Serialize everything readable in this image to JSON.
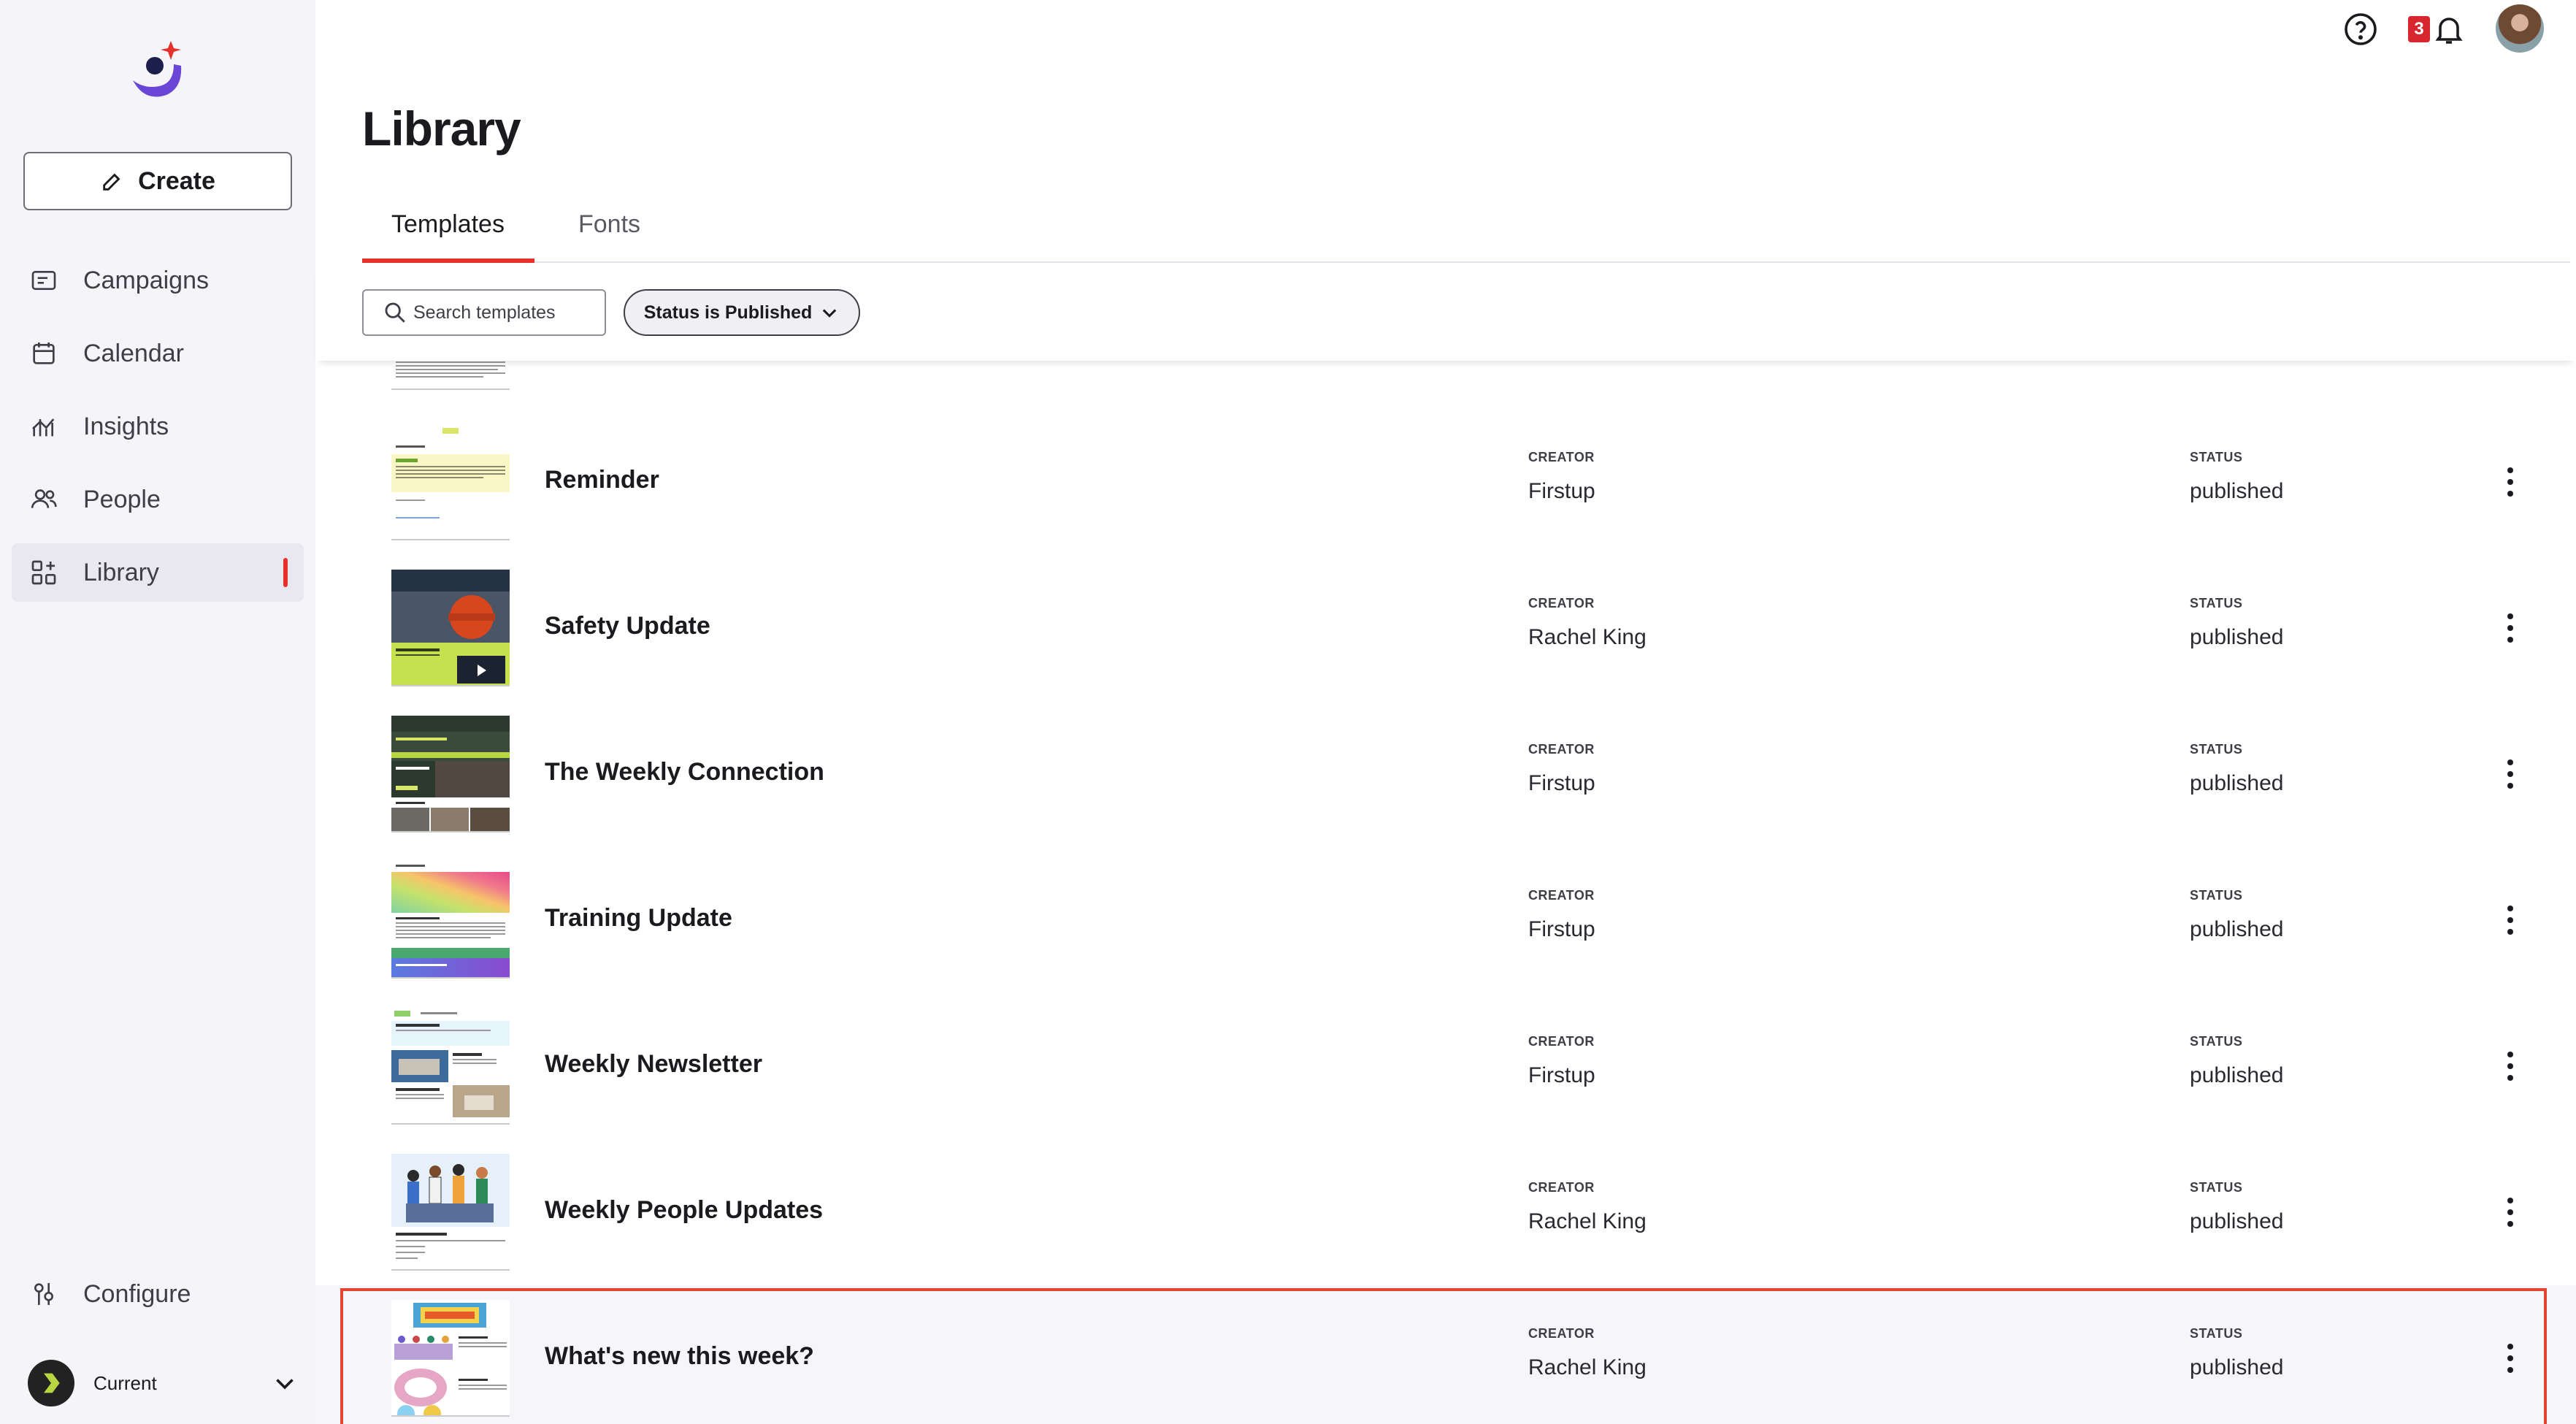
{
  "app": {
    "colors": {
      "accent": "#e6312b",
      "sidebar_bg": "#f5f4f8",
      "text": "#1b1b1f"
    }
  },
  "sidebar": {
    "create_label": "Create",
    "items": [
      {
        "label": "Campaigns",
        "icon": "campaigns-icon"
      },
      {
        "label": "Calendar",
        "icon": "calendar-icon"
      },
      {
        "label": "Insights",
        "icon": "insights-icon"
      },
      {
        "label": "People",
        "icon": "people-icon"
      },
      {
        "label": "Library",
        "icon": "library-icon",
        "active": true
      }
    ],
    "configure_label": "Configure",
    "workspace_label": "Current"
  },
  "topbar": {
    "notification_count": "3"
  },
  "page": {
    "title": "Library",
    "tabs": [
      {
        "label": "Templates",
        "active": true
      },
      {
        "label": "Fonts",
        "active": false
      }
    ],
    "search_placeholder": "Search templates",
    "filter_label": "Status is Published"
  },
  "list": {
    "creator_header": "CREATOR",
    "status_header": "STATUS",
    "rows": [
      {
        "title": "Reminder",
        "creator": "Firstup",
        "status": "published"
      },
      {
        "title": "Safety Update",
        "creator": "Rachel King",
        "status": "published"
      },
      {
        "title": "The Weekly Connection",
        "creator": "Firstup",
        "status": "published"
      },
      {
        "title": "Training Update",
        "creator": "Firstup",
        "status": "published"
      },
      {
        "title": "Weekly Newsletter",
        "creator": "Firstup",
        "status": "published"
      },
      {
        "title": "Weekly People Updates",
        "creator": "Rachel King",
        "status": "published"
      },
      {
        "title": "What's new this week?",
        "creator": "Rachel King",
        "status": "published"
      }
    ]
  }
}
